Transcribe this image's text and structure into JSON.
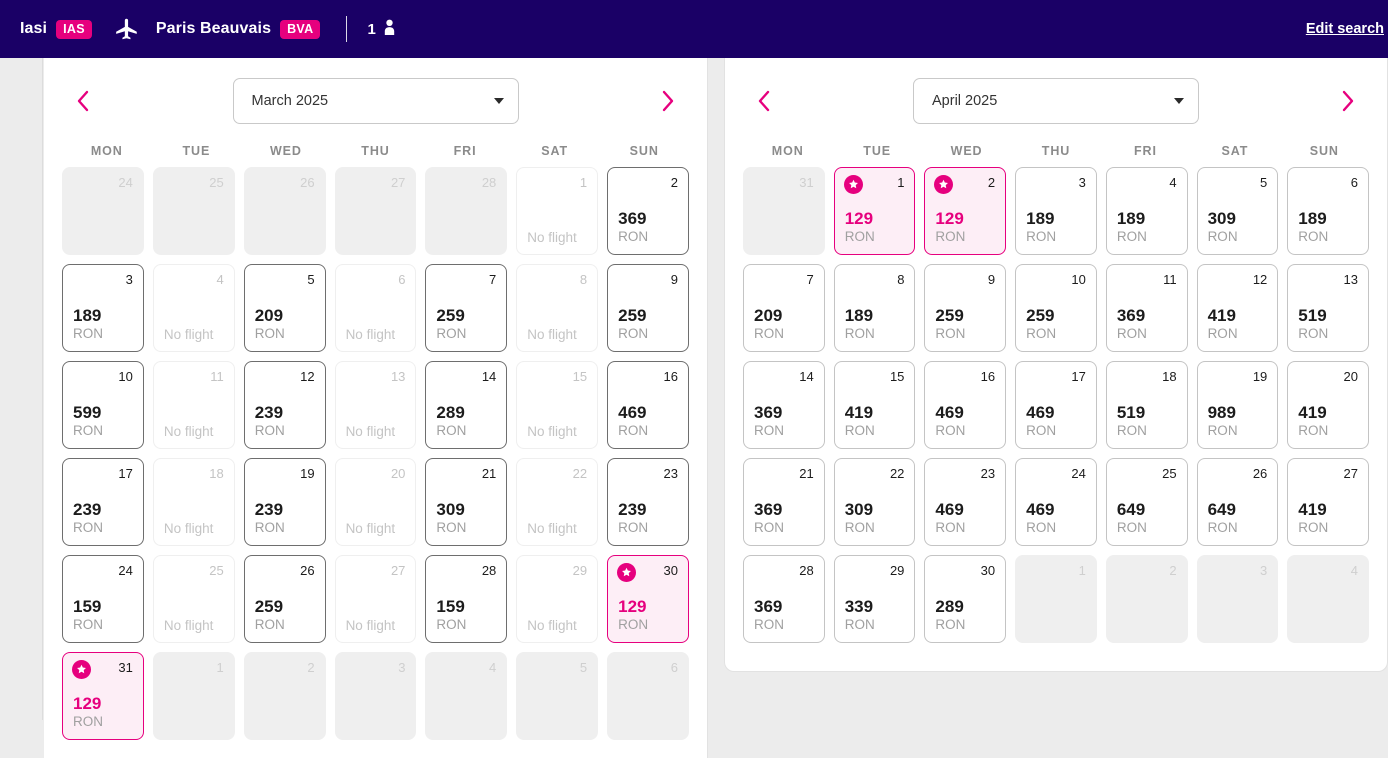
{
  "header": {
    "origin_city": "Iasi",
    "origin_code": "IAS",
    "plane_icon": "airplane-icon",
    "destination_city": "Paris Beauvais",
    "destination_code": "BVA",
    "passenger_count": "1",
    "passenger_icon": "person-icon",
    "edit_search_label": "Edit search",
    "bar_color": "#1a0066",
    "badge_color": "#e6007e"
  },
  "weekdays": [
    "MON",
    "TUE",
    "WED",
    "THU",
    "FRI",
    "SAT",
    "SUN"
  ],
  "currency": "RON",
  "no_flight_label": "No flight",
  "accent_color": "#e6007e",
  "months": [
    {
      "id": "march",
      "select_label": "March 2025",
      "prev_icon": "chevron-left-icon",
      "next_icon": "chevron-right-icon",
      "caret_icon": "chevron-down-icon",
      "days": [
        {
          "num": "24",
          "state": "blank"
        },
        {
          "num": "25",
          "state": "blank"
        },
        {
          "num": "26",
          "state": "blank"
        },
        {
          "num": "27",
          "state": "blank"
        },
        {
          "num": "28",
          "state": "blank"
        },
        {
          "num": "1",
          "state": "noflight"
        },
        {
          "num": "2",
          "state": "avail",
          "price": "369"
        },
        {
          "num": "3",
          "state": "avail",
          "price": "189"
        },
        {
          "num": "4",
          "state": "noflight"
        },
        {
          "num": "5",
          "state": "avail",
          "price": "209"
        },
        {
          "num": "6",
          "state": "noflight"
        },
        {
          "num": "7",
          "state": "avail",
          "price": "259"
        },
        {
          "num": "8",
          "state": "noflight"
        },
        {
          "num": "9",
          "state": "avail",
          "price": "259"
        },
        {
          "num": "10",
          "state": "avail",
          "price": "599"
        },
        {
          "num": "11",
          "state": "noflight"
        },
        {
          "num": "12",
          "state": "avail",
          "price": "239"
        },
        {
          "num": "13",
          "state": "noflight"
        },
        {
          "num": "14",
          "state": "avail",
          "price": "289"
        },
        {
          "num": "15",
          "state": "noflight"
        },
        {
          "num": "16",
          "state": "avail",
          "price": "469"
        },
        {
          "num": "17",
          "state": "avail",
          "price": "239"
        },
        {
          "num": "18",
          "state": "noflight"
        },
        {
          "num": "19",
          "state": "avail",
          "price": "239"
        },
        {
          "num": "20",
          "state": "noflight"
        },
        {
          "num": "21",
          "state": "avail",
          "price": "309"
        },
        {
          "num": "22",
          "state": "noflight"
        },
        {
          "num": "23",
          "state": "avail",
          "price": "239"
        },
        {
          "num": "24",
          "state": "avail",
          "price": "159"
        },
        {
          "num": "25",
          "state": "noflight"
        },
        {
          "num": "26",
          "state": "avail",
          "price": "259"
        },
        {
          "num": "27",
          "state": "noflight"
        },
        {
          "num": "28",
          "state": "avail",
          "price": "159"
        },
        {
          "num": "29",
          "state": "noflight"
        },
        {
          "num": "30",
          "state": "cheap",
          "price": "129",
          "star": true
        },
        {
          "num": "31",
          "state": "cheap",
          "price": "129",
          "star": true
        },
        {
          "num": "1",
          "state": "blank"
        },
        {
          "num": "2",
          "state": "blank"
        },
        {
          "num": "3",
          "state": "blank"
        },
        {
          "num": "4",
          "state": "blank"
        },
        {
          "num": "5",
          "state": "blank"
        },
        {
          "num": "6",
          "state": "blank"
        }
      ]
    },
    {
      "id": "april",
      "select_label": "April 2025",
      "prev_icon": "chevron-left-icon",
      "next_icon": "chevron-right-icon",
      "caret_icon": "chevron-down-icon",
      "days": [
        {
          "num": "31",
          "state": "blank"
        },
        {
          "num": "1",
          "state": "cheap",
          "price": "129",
          "star": true
        },
        {
          "num": "2",
          "state": "cheap",
          "price": "129",
          "star": true
        },
        {
          "num": "3",
          "state": "avail",
          "price": "189"
        },
        {
          "num": "4",
          "state": "avail",
          "price": "189"
        },
        {
          "num": "5",
          "state": "avail",
          "price": "309"
        },
        {
          "num": "6",
          "state": "avail",
          "price": "189"
        },
        {
          "num": "7",
          "state": "avail",
          "price": "209"
        },
        {
          "num": "8",
          "state": "avail",
          "price": "189"
        },
        {
          "num": "9",
          "state": "avail",
          "price": "259"
        },
        {
          "num": "10",
          "state": "avail",
          "price": "259"
        },
        {
          "num": "11",
          "state": "avail",
          "price": "369"
        },
        {
          "num": "12",
          "state": "avail",
          "price": "419"
        },
        {
          "num": "13",
          "state": "avail",
          "price": "519"
        },
        {
          "num": "14",
          "state": "avail",
          "price": "369"
        },
        {
          "num": "15",
          "state": "avail",
          "price": "419"
        },
        {
          "num": "16",
          "state": "avail",
          "price": "469"
        },
        {
          "num": "17",
          "state": "avail",
          "price": "469"
        },
        {
          "num": "18",
          "state": "avail",
          "price": "519"
        },
        {
          "num": "19",
          "state": "avail",
          "price": "989"
        },
        {
          "num": "20",
          "state": "avail",
          "price": "419"
        },
        {
          "num": "21",
          "state": "avail",
          "price": "369"
        },
        {
          "num": "22",
          "state": "avail",
          "price": "309"
        },
        {
          "num": "23",
          "state": "avail",
          "price": "469"
        },
        {
          "num": "24",
          "state": "avail",
          "price": "469"
        },
        {
          "num": "25",
          "state": "avail",
          "price": "649"
        },
        {
          "num": "26",
          "state": "avail",
          "price": "649"
        },
        {
          "num": "27",
          "state": "avail",
          "price": "419"
        },
        {
          "num": "28",
          "state": "avail",
          "price": "369"
        },
        {
          "num": "29",
          "state": "avail",
          "price": "339"
        },
        {
          "num": "30",
          "state": "avail",
          "price": "289"
        },
        {
          "num": "1",
          "state": "blank"
        },
        {
          "num": "2",
          "state": "blank"
        },
        {
          "num": "3",
          "state": "blank"
        },
        {
          "num": "4",
          "state": "blank"
        }
      ]
    }
  ]
}
